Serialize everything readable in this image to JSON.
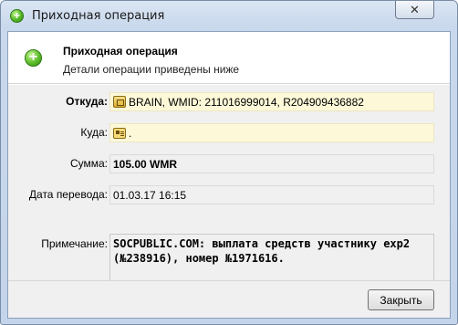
{
  "window": {
    "title": "Приходная операция",
    "close_glyph": "✕"
  },
  "header": {
    "title": "Приходная операция",
    "subtitle": "Детали операции приведены ниже",
    "icon": "plus-circle-icon"
  },
  "form": {
    "from": {
      "label": "Откуда:",
      "value": "BRAIN, WMID: 211016999014, R204909436882",
      "icon": "purse-icon"
    },
    "to": {
      "label": "Куда:",
      "value": ".",
      "icon": "card-icon"
    },
    "amount": {
      "label": "Сумма:",
      "value": "105.00 WMR"
    },
    "date": {
      "label": "Дата перевода:",
      "value": "01.03.17 16:15"
    },
    "note": {
      "label": "Примечание:",
      "value": "SOCPUBLIC.COM: выплата средств участнику exp2 (№238916), номер №1971616."
    }
  },
  "footer": {
    "close_label": "Закрыть"
  },
  "colors": {
    "title_bg": "#c9d8ec",
    "field_yellow": "#fdf9d8",
    "accent_green": "#55b626"
  }
}
